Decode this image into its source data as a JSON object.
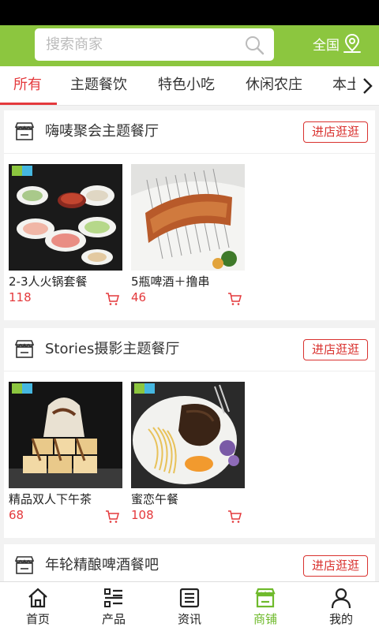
{
  "header": {
    "search_placeholder": "搜索商家",
    "region_label": "全国"
  },
  "tabs": [
    {
      "label": "所有",
      "active": true
    },
    {
      "label": "主题餐饮",
      "active": false
    },
    {
      "label": "特色小吃",
      "active": false
    },
    {
      "label": "休闲农庄",
      "active": false
    },
    {
      "label": "本土",
      "active": false
    }
  ],
  "shops": [
    {
      "name": "嗨唛聚会主题餐厅",
      "enter_label": "进店逛逛",
      "products": [
        {
          "name": "2-3人火锅套餐",
          "price": "118"
        },
        {
          "name": "5瓶啤酒＋撸串",
          "price": "46"
        }
      ]
    },
    {
      "name": "Stories摄影主题餐厅",
      "enter_label": "进店逛逛",
      "products": [
        {
          "name": "精品双人下午茶",
          "price": "68"
        },
        {
          "name": "蜜恋午餐",
          "price": "108"
        }
      ]
    },
    {
      "name": "年轮精酿啤酒餐吧",
      "enter_label": "进店逛逛",
      "products": []
    }
  ],
  "bottom_nav": [
    {
      "label": "首页",
      "icon": "home-icon",
      "active": false
    },
    {
      "label": "产品",
      "icon": "list-icon",
      "active": false
    },
    {
      "label": "资讯",
      "icon": "news-icon",
      "active": false
    },
    {
      "label": "商铺",
      "icon": "shop-icon",
      "active": true
    },
    {
      "label": "我的",
      "icon": "user-icon",
      "active": false
    }
  ],
  "colors": {
    "brand_green": "#8cc63f",
    "accent_red": "#e4393c",
    "nav_active": "#6fba2c"
  }
}
